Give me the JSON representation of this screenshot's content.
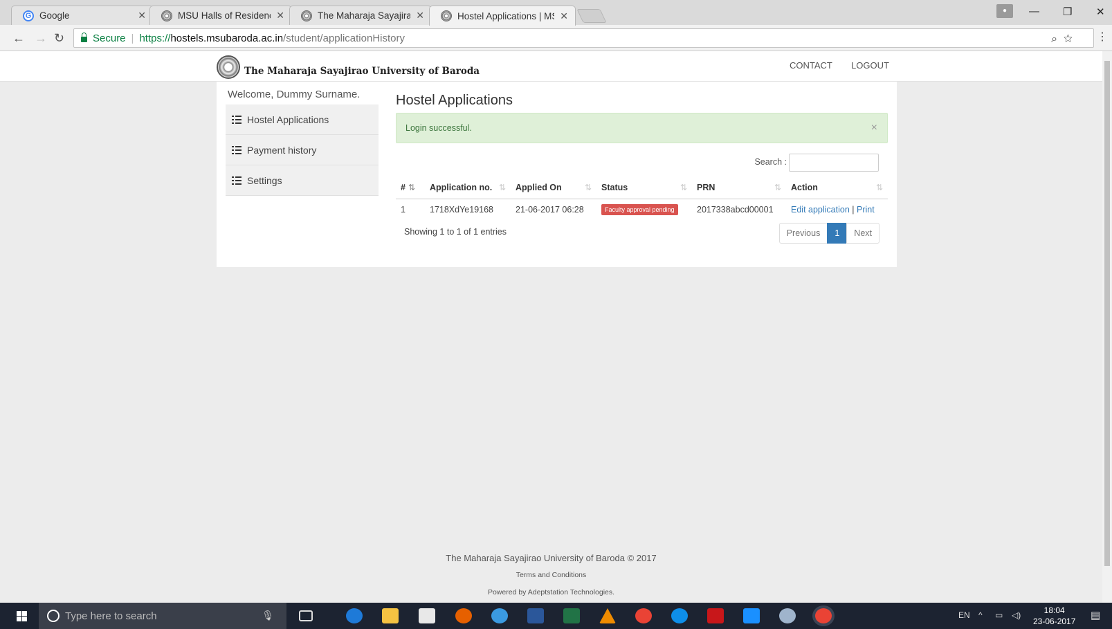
{
  "browser": {
    "tabs": [
      {
        "title": "Google",
        "favicon": "google-icon"
      },
      {
        "title": "MSU Halls of Residence",
        "favicon": "msu-seal-icon"
      },
      {
        "title": "The Maharaja Sayajirao U",
        "favicon": "msu-seal-icon"
      },
      {
        "title": "Hostel Applications | MSU",
        "favicon": "msu-seal-icon"
      }
    ],
    "secure_label": "Secure",
    "url_scheme": "https://",
    "url_host": "hostels.msubaroda.ac.in",
    "url_path": "/student/applicationHistory"
  },
  "site": {
    "brand": "The Maharaja Sayajirao University of Baroda",
    "nav": {
      "contact": "CONTACT",
      "logout": "LOGOUT"
    }
  },
  "sidebar": {
    "welcome": "Welcome, Dummy Surname.",
    "items": [
      {
        "label": "Hostel Applications"
      },
      {
        "label": "Payment history"
      },
      {
        "label": "Settings"
      }
    ]
  },
  "main": {
    "title": "Hostel Applications",
    "alert": "Login successful.",
    "alert_close": "×",
    "search_label": "Search :",
    "table": {
      "headers": [
        "#",
        "Application no.",
        "Applied On",
        "Status",
        "PRN",
        "Action"
      ],
      "rows": [
        {
          "num": "1",
          "application_no": "1718XdYe19168",
          "applied_on": "21-06-2017 06:28",
          "status": "Faculty approval pending",
          "prn": "2017338abcd00001",
          "action_edit": "Edit application",
          "action_sep": "|",
          "action_print": "Print"
        }
      ]
    },
    "info": "Showing 1 to 1 of 1 entries",
    "pagination": {
      "previous": "Previous",
      "current": "1",
      "next": "Next"
    }
  },
  "footer": {
    "copyright": "The Maharaja Sayajirao University of Baroda © 2017",
    "terms": "Terms and Conditions",
    "powered": "Powered by Adeptstation Technologies."
  },
  "taskbar": {
    "search_placeholder": "Type here to search",
    "language": "EN",
    "time": "18:04",
    "date": "23-06-2017"
  },
  "colors": {
    "primary": "#337ab7",
    "alert_bg": "#dff0d8",
    "alert_text": "#3c763d",
    "status_badge": "#d9534f",
    "secure": "#0b8043"
  }
}
